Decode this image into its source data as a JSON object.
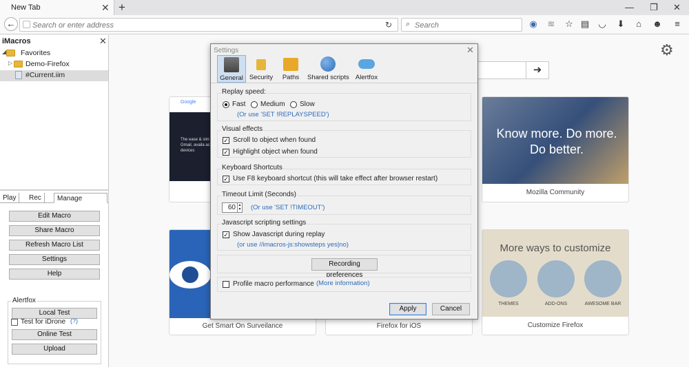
{
  "browser": {
    "tab_title": "New Tab",
    "url_placeholder": "Search or enter address",
    "search_placeholder": "Search"
  },
  "sidebar": {
    "title": "iMacros",
    "tree": [
      {
        "label": "Favorites",
        "kind": "folder",
        "expanded": true
      },
      {
        "label": "Demo-Firefox",
        "kind": "folder",
        "expanded": false
      },
      {
        "label": "#Current.iim",
        "kind": "file",
        "selected": true
      }
    ],
    "tabs": [
      "Play",
      "Rec",
      "Manage"
    ],
    "active_tab": "Manage",
    "buttons": [
      "Edit Macro",
      "Share Macro",
      "Refresh Macro List",
      "Settings",
      "Help"
    ],
    "alertfox": {
      "title": "Alertfox",
      "local_test": "Local Test",
      "test_for_idrone": "Test for iDrone",
      "help": "(?)",
      "online_test": "Online Test",
      "upload": "Upload"
    }
  },
  "newtab": {
    "tiles": [
      {
        "label": "",
        "thumb_text": "The ease & sim of Gmail, availa across devices"
      },
      {
        "label": "Mozilla Community",
        "thumb_text": "Know more. Do more. Do better."
      },
      {
        "label": "Get Smart On Surveilance",
        "thumb_text": ""
      },
      {
        "label": "Firefox for iOS",
        "thumb_text": ""
      },
      {
        "label": "Customize Firefox",
        "thumb_text": "More ways to customize",
        "items": [
          "THEMES",
          "ADD-ONS",
          "AWESOME BAR"
        ]
      }
    ],
    "google_label": "Google"
  },
  "dialog": {
    "title": "Settings",
    "tabs": [
      "General",
      "Security",
      "Paths",
      "Shared scripts",
      "Alertfox"
    ],
    "active_tab": "General",
    "replay": {
      "title": "Replay speed:",
      "options": [
        "Fast",
        "Medium",
        "Slow"
      ],
      "selected": "Fast",
      "hint": "(Or use 'SET !REPLAYSPEED')"
    },
    "visual": {
      "title": "Visual effects",
      "scroll": "Scroll to object when found",
      "highlight": "Highlight object when found"
    },
    "keyboard": {
      "title": "Keyboard Shortcuts",
      "f8": "Use F8 keyboard shortcut (this will take effect after browser restart)"
    },
    "timeout": {
      "title": "Timeout Limit (Seconds)",
      "value": "60",
      "hint": "(Or use 'SET !TIMEOUT')"
    },
    "javascript": {
      "title": "Javascript scripting settings",
      "show": "Show Javascript during replay",
      "hint": "(or use //imacros-js:showsteps yes|no)"
    },
    "recording_prefs": "Recording preferences",
    "profile": {
      "label": "Profile macro performance",
      "more_info": "(More information)"
    },
    "apply": "Apply",
    "cancel": "Cancel"
  }
}
